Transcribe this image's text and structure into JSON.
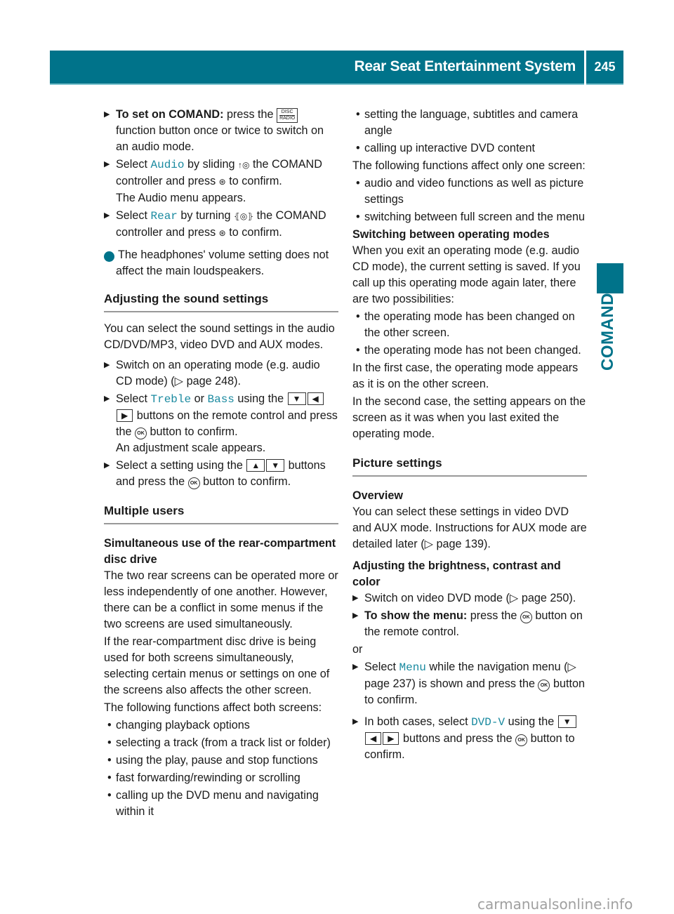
{
  "header": {
    "title": "Rear Seat Entertainment System",
    "page_number": "245",
    "side_tab": "COMAND",
    "accent_color": "#00738a"
  },
  "left": {
    "step1": {
      "bold": "To set on COMAND:",
      "pre": " press the ",
      "key_top": "DISC",
      "key_bottom": "RADIO",
      "post": " function button once or twice to switch on an audio mode."
    },
    "step2": {
      "pre": "Select ",
      "hl": "Audio",
      "mid": " by sliding ",
      "ctrl": "↑◎",
      "mid2": " the COMAND controller and press ",
      "press": "⊛",
      "post": " to confirm.",
      "result": "The Audio menu appears."
    },
    "step3": {
      "pre": "Select ",
      "hl": "Rear",
      "mid": " by turning ",
      "ctrl": "⦃◎⦄",
      "mid2": " the COMAND controller and press ",
      "press": "⊛",
      "post": " to confirm."
    },
    "info": "The headphones' volume setting does not affect the main loudspeakers.",
    "section1": {
      "heading": "Adjusting the sound settings",
      "intro": "You can select the sound settings in the audio CD/DVD/MP3, video DVD and AUX modes.",
      "step1": "Switch on an operating mode (e.g. audio CD mode) (▷ page 248).",
      "step2": {
        "pre": "Select ",
        "hl1": "Treble",
        "or": " or ",
        "hl2": "Bass",
        "using": " using the ",
        "keys": [
          "▼",
          "◀",
          "▶"
        ],
        "mid": " buttons on the remote control and press the ",
        "ok": "OK",
        "post": " button to confirm.",
        "result": "An adjustment scale appears."
      },
      "step3": {
        "pre": "Select a setting using the ",
        "keys": [
          "▲",
          "▼"
        ],
        "mid": " buttons and press the ",
        "ok": "OK",
        "post": " button to confirm."
      }
    },
    "section2": {
      "heading": "Multiple users",
      "subheading": "Simultaneous use of the rear-compartment disc drive",
      "para1": "The two rear screens can be operated more or less independently of one another. However, there can be a conflict in some menus if the two screens are used simultaneously.",
      "para2": "If the rear-compartment disc drive is being used for both screens simultaneously, selecting certain menus or settings on one of the screens also affects the other screen.",
      "para3": "The following functions affect both screens:",
      "bullets": [
        "changing playback options",
        "selecting a track (from a track list or folder)",
        "using the play, pause and stop functions",
        "fast forwarding/rewinding or scrolling",
        "calling up the DVD menu and navigating within it"
      ]
    }
  },
  "right": {
    "bullets_both": [
      "setting the language, subtitles and camera angle",
      "calling up interactive DVD content"
    ],
    "para_one": "The following functions affect only one screen:",
    "bullets_one": [
      "audio and video functions as well as picture settings",
      "switching between full screen and the menu"
    ],
    "switching": {
      "heading": "Switching between operating modes",
      "para": "When you exit an operating mode (e.g. audio CD mode), the current setting is saved. If you call up this operating mode again later, there are two possibilities:",
      "bullets": [
        "the operating mode has been changed on the other screen.",
        "the operating mode has not been changed."
      ],
      "para2": "In the first case, the operating mode appears as it is on the other screen.",
      "para3": "In the second case, the setting appears on the screen as it was when you last exited the operating mode."
    },
    "picture": {
      "heading": "Picture settings",
      "overview_heading": "Overview",
      "overview": "You can select these settings in video DVD and AUX mode. Instructions for AUX mode are detailed later (▷ page 139).",
      "adjust_heading": "Adjusting the brightness, contrast and color",
      "step1": "Switch on video DVD mode (▷ page 250).",
      "step2": {
        "bold": "To show the menu:",
        "pre": " press the ",
        "ok": "OK",
        "post": " button on the remote control."
      },
      "or": "or",
      "step3": {
        "pre": "Select ",
        "hl": "Menu",
        "mid": " while the navigation menu (▷ page 237) is shown and press the ",
        "ok": "OK",
        "post": " button to confirm."
      },
      "step4": {
        "pre": "In both cases, select ",
        "hl": "DVD-V",
        "using": " using the ",
        "keys": [
          "▼",
          "◀",
          "▶"
        ],
        "mid": " buttons and press the ",
        "ok": "OK",
        "post": " button to confirm."
      }
    }
  },
  "watermark": "carmanualsonline.info"
}
